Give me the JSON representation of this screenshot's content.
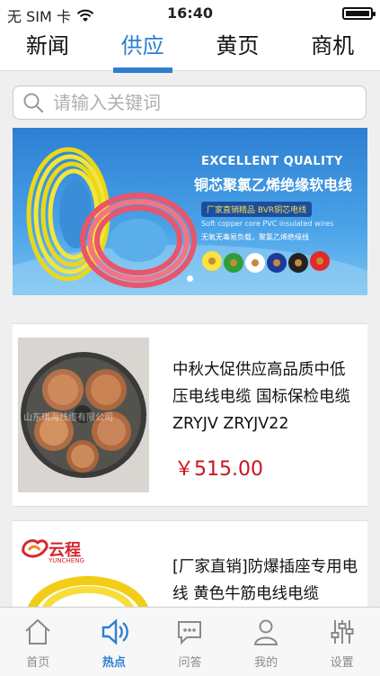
{
  "status_bar": {
    "carrier": "无 SIM 卡",
    "time": "16:40",
    "battery_level": 0.9
  },
  "top_tabs": [
    {
      "label": "新闻"
    },
    {
      "label": "供应"
    },
    {
      "label": "黄页"
    },
    {
      "label": "商机"
    }
  ],
  "active_top_tab": "供应",
  "search": {
    "placeholder": "请输入关键词",
    "value": ""
  },
  "banner": {
    "title_en": "EXCELLENT QUALITY",
    "title_cn": "铜芯聚氯乙烯绝缘软电线",
    "tag": "厂家直销精品  BVR铜芯电线",
    "sub_en": "Soft copper core PVC insulated wires",
    "sub_cn": "无氧无毒易负载，聚氯乙烯绝缘线"
  },
  "products": [
    {
      "title": "中秋大促供应高品质中低压电线电缆 国标保检电缆 ZRYJV ZRYJV22",
      "price": "￥515.00",
      "watermark": "山东琪海线缆有限公司"
    },
    {
      "title": "[厂家直销]防爆插座专用电线 黄色牛筋电线电缆",
      "brand": "云程",
      "brand_en": "YUNCHENG"
    }
  ],
  "bottom_nav": [
    {
      "label": "首页",
      "icon": "home-icon"
    },
    {
      "label": "热点",
      "icon": "speaker-icon"
    },
    {
      "label": "问答",
      "icon": "chat-icon"
    },
    {
      "label": "我的",
      "icon": "person-icon"
    },
    {
      "label": "设置",
      "icon": "sliders-icon"
    }
  ],
  "active_bottom_nav": "热点",
  "colors": {
    "accent": "#2e7fd0",
    "price": "#c8161d"
  }
}
